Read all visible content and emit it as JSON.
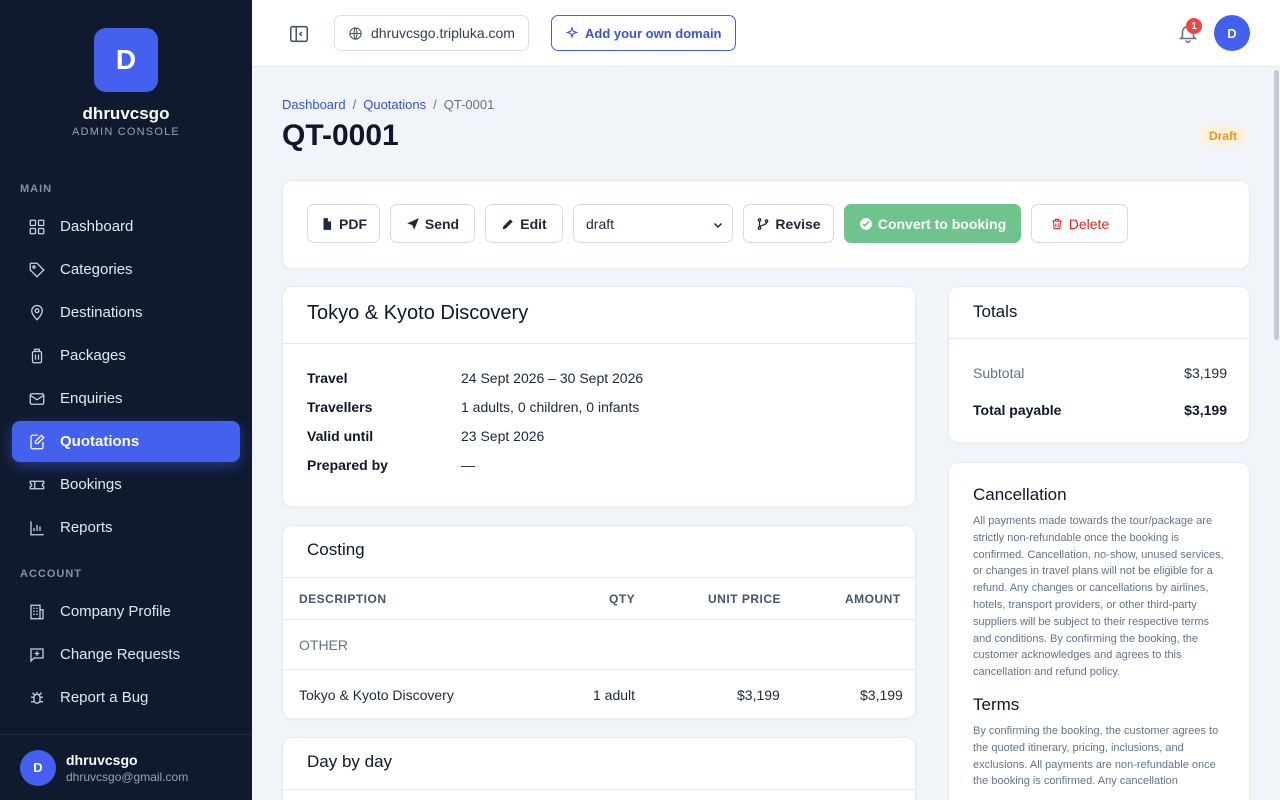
{
  "brand": {
    "initial": "D",
    "name": "dhruvcsgo",
    "subtitle": "ADMIN CONSOLE"
  },
  "sidebar": {
    "sections": {
      "main": "MAIN",
      "account": "ACCOUNT"
    },
    "items": [
      {
        "label": "Dashboard",
        "icon": "grid-icon"
      },
      {
        "label": "Categories",
        "icon": "tag-icon"
      },
      {
        "label": "Destinations",
        "icon": "map-pin-icon"
      },
      {
        "label": "Packages",
        "icon": "luggage-icon"
      },
      {
        "label": "Enquiries",
        "icon": "mail-icon"
      },
      {
        "label": "Quotations",
        "icon": "edit-document-icon",
        "active": true
      },
      {
        "label": "Bookings",
        "icon": "ticket-icon"
      },
      {
        "label": "Reports",
        "icon": "bar-chart-icon"
      },
      {
        "label": "Company Profile",
        "icon": "building-icon"
      },
      {
        "label": "Change Requests",
        "icon": "message-plus-icon"
      },
      {
        "label": "Report a Bug",
        "icon": "bug-icon"
      }
    ],
    "user": {
      "initial": "D",
      "name": "dhruvcsgo",
      "email": "dhruvcsgo@gmail.com"
    }
  },
  "topbar": {
    "domain": "dhruvcsgo.tripluka.com",
    "add_domain": "Add your own domain",
    "notification_count": "1",
    "avatar_initial": "D"
  },
  "breadcrumb": {
    "dashboard": "Dashboard",
    "quotations": "Quotations",
    "current": "QT-0001",
    "sep": "/"
  },
  "page": {
    "title": "QT-0001",
    "status_badge": "Draft"
  },
  "actions": {
    "pdf": "PDF",
    "send": "Send",
    "edit": "Edit",
    "status_value": "draft",
    "revise": "Revise",
    "convert": "Convert to booking",
    "delete": "Delete"
  },
  "trip": {
    "title": "Tokyo & Kyoto Discovery",
    "rows": [
      {
        "key": "Travel",
        "value": "24 Sept 2026 – 30 Sept 2026"
      },
      {
        "key": "Travellers",
        "value": "1 adults, 0 children, 0 infants"
      },
      {
        "key": "Valid until",
        "value": "23 Sept 2026"
      },
      {
        "key": "Prepared by",
        "value": "—"
      }
    ]
  },
  "costing": {
    "title": "Costing",
    "headers": {
      "description": "DESCRIPTION",
      "qty": "QTY",
      "unit_price": "UNIT PRICE",
      "amount": "AMOUNT"
    },
    "group": "OTHER",
    "rows": [
      {
        "description": "Tokyo & Kyoto Discovery",
        "qty": "1 adult",
        "unit_price": "$3,199",
        "amount": "$3,199"
      }
    ]
  },
  "day_by_day": {
    "title": "Day by day"
  },
  "totals": {
    "title": "Totals",
    "subtotal_label": "Subtotal",
    "subtotal": "$3,199",
    "payable_label": "Total payable",
    "payable": "$3,199"
  },
  "policies": {
    "cancellation_title": "Cancellation",
    "cancellation_text": "All payments made towards the tour/package are strictly non-refundable once the booking is confirmed. Cancellation, no-show, unused services, or changes in travel plans will not be eligible for a refund. Any changes or cancellations by airlines, hotels, transport providers, or other third-party suppliers will be subject to their respective terms and conditions. By confirming the booking, the customer acknowledges and agrees to this cancellation and refund policy.",
    "terms_title": "Terms",
    "terms_text": "By confirming the booking, the customer agrees to the quoted itinerary, pricing, inclusions, and exclusions. All payments are non-refundable once the booking is confirmed. Any cancellation"
  }
}
